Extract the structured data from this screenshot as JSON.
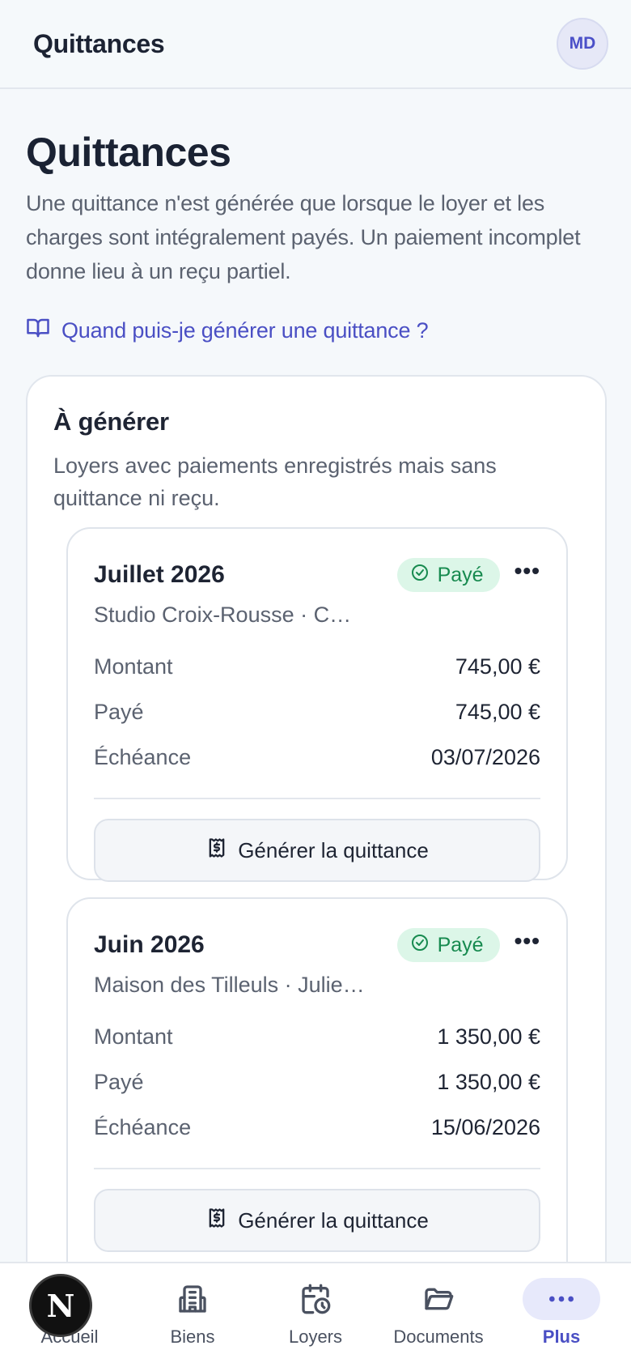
{
  "header": {
    "title": "Quittances",
    "avatar_initials": "MD"
  },
  "page": {
    "title": "Quittances",
    "description": "Une quittance n'est générée que lorsque le loyer et les charges sont intégralement payés. Un paiement incomplet donne lieu à un reçu partiel.",
    "help_link": "Quand puis-je générer une quittance ?"
  },
  "section": {
    "title": "À générer",
    "description": "Loyers avec paiements enregistrés mais sans quittance ni reçu."
  },
  "cards": [
    {
      "month": "Juillet 2026",
      "property": "Studio Croix-Rousse · C…",
      "status": "Payé",
      "rows": [
        {
          "label": "Montant",
          "value": "745,00 €"
        },
        {
          "label": "Payé",
          "value": "745,00 €"
        },
        {
          "label": "Échéance",
          "value": "03/07/2026"
        }
      ],
      "action": "Générer la quittance"
    },
    {
      "month": "Juin 2026",
      "property": "Maison des Tilleuls · Julie…",
      "status": "Payé",
      "rows": [
        {
          "label": "Montant",
          "value": "1 350,00 €"
        },
        {
          "label": "Payé",
          "value": "1 350,00 €"
        },
        {
          "label": "Échéance",
          "value": "15/06/2026"
        }
      ],
      "action": "Générer la quittance"
    }
  ],
  "nav": {
    "items": [
      {
        "label": "Accueil",
        "icon": "home-icon"
      },
      {
        "label": "Biens",
        "icon": "building-icon"
      },
      {
        "label": "Loyers",
        "icon": "calendar-clock-icon"
      },
      {
        "label": "Documents",
        "icon": "folder-icon"
      },
      {
        "label": "Plus",
        "icon": "more-horizontal-icon"
      }
    ],
    "active": "Plus",
    "dev_badge": "N"
  },
  "colors": {
    "accent": "#4a4fc4",
    "paid_bg": "#dcf6e8",
    "paid_text": "#178a4f",
    "background": "#f5f8fb"
  }
}
